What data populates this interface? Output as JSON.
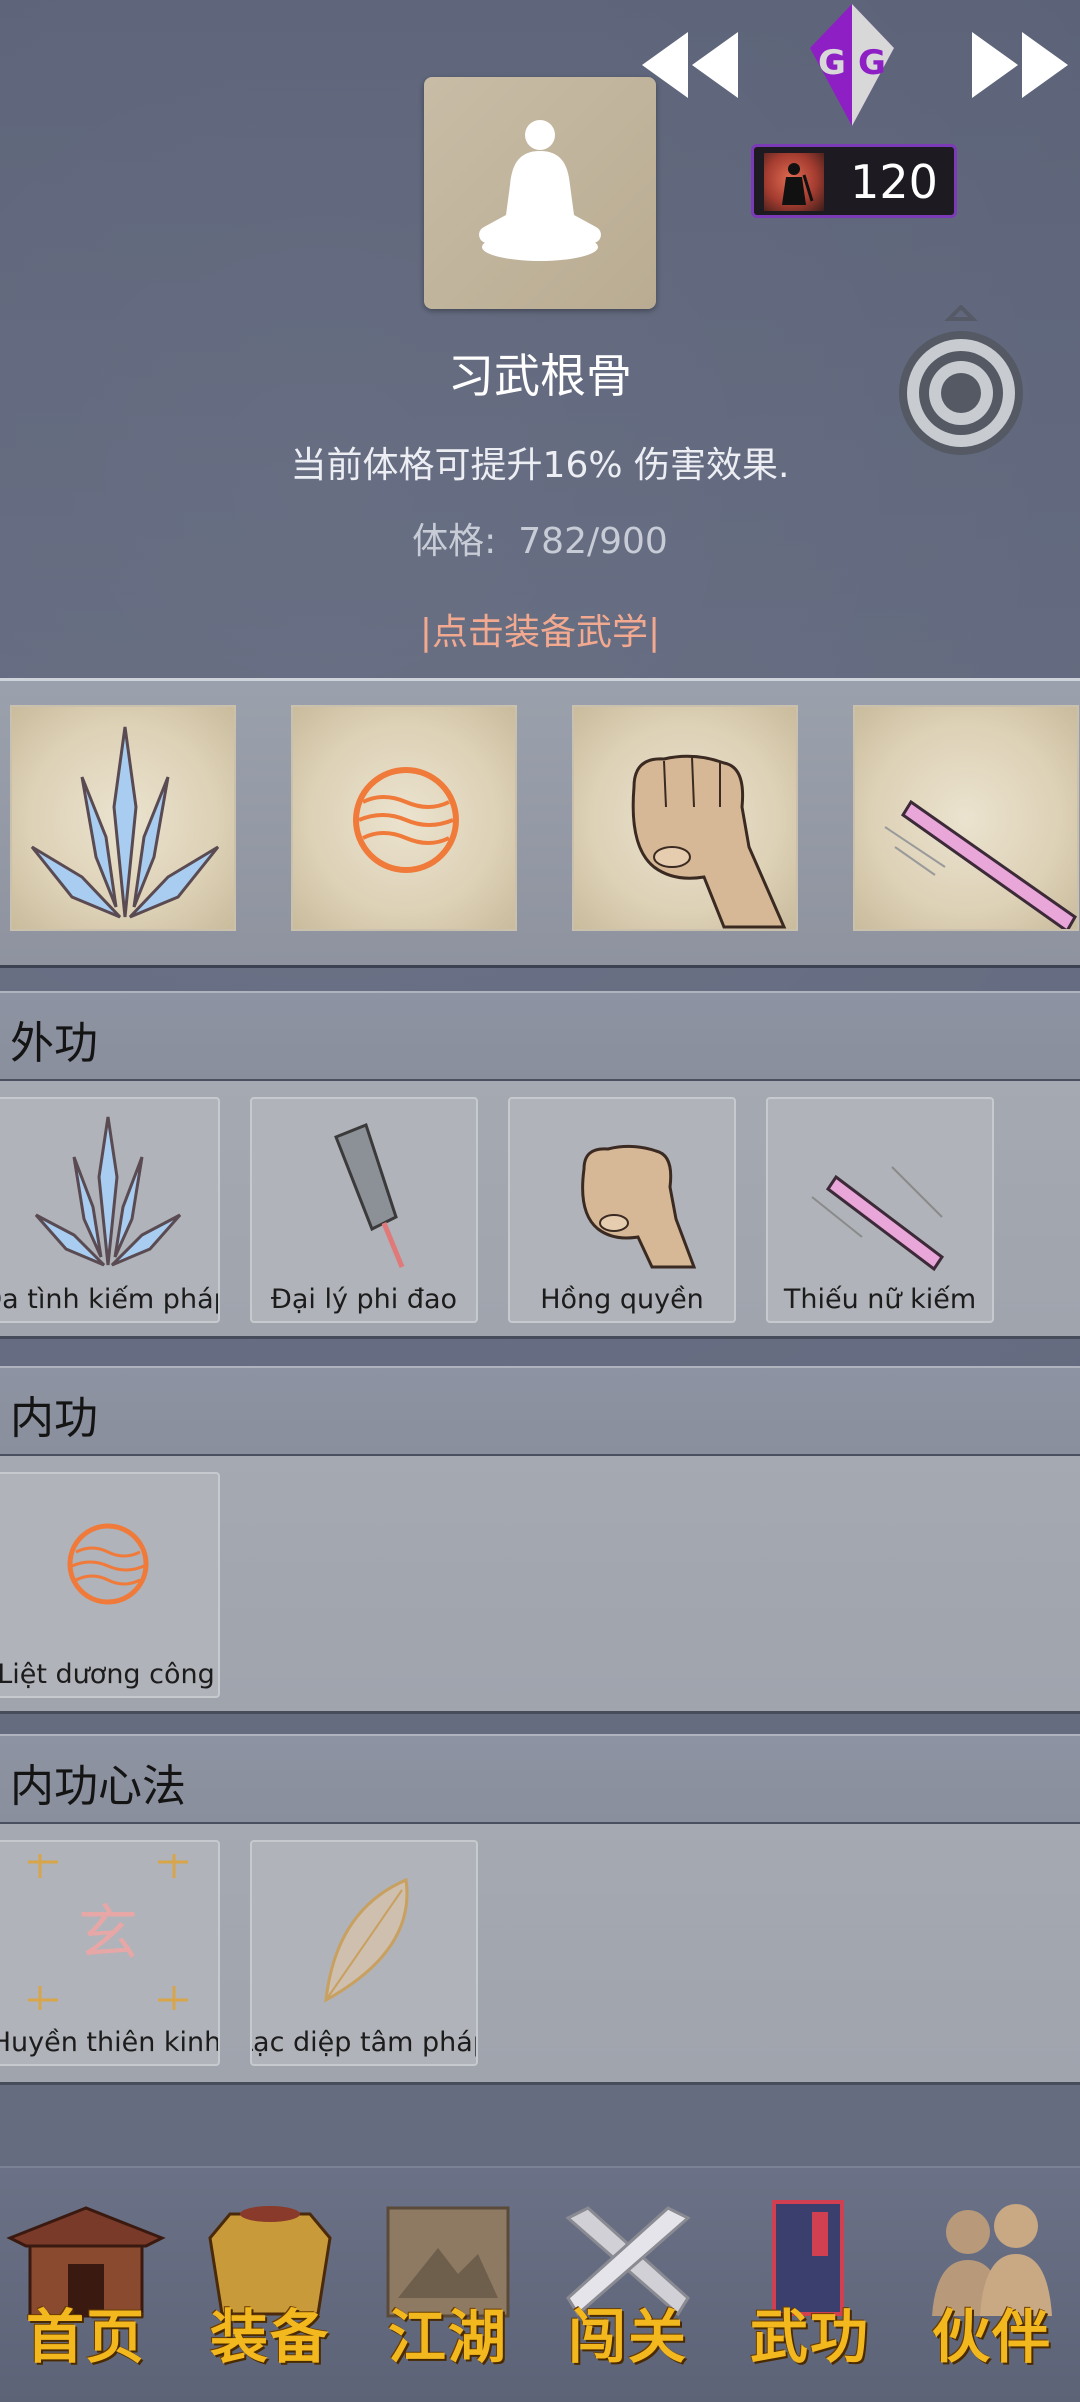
{
  "header": {
    "title": "习武根骨",
    "description": "当前体格可提升16% 伤害效果.",
    "stat_label": "体格:",
    "stat_value": "782/900",
    "equip_link": "|点击装备武学|",
    "coin_count": "120"
  },
  "equipped_slots": [
    {
      "icon": "crystal-sword-icon"
    },
    {
      "icon": "fire-orb-icon"
    },
    {
      "icon": "fist-icon"
    },
    {
      "icon": "pink-sword-icon"
    }
  ],
  "sections": [
    {
      "title": "外功",
      "items": [
        {
          "label": "Đa tình kiếm pháp",
          "icon": "crystal-sword-icon"
        },
        {
          "label": "Đại lý phi đao",
          "icon": "cleaver-icon"
        },
        {
          "label": "Hồng quyền",
          "icon": "fist-icon"
        },
        {
          "label": "Thiếu nữ kiếm",
          "icon": "pink-sword-icon"
        }
      ]
    },
    {
      "title": "内功",
      "items": [
        {
          "label": "Liệt dương công",
          "icon": "fire-orb-icon"
        }
      ]
    },
    {
      "title": "内功心法",
      "items": [
        {
          "label": "Huyền thiên kinh",
          "icon": "xuan-scroll-icon"
        },
        {
          "label": "Lạc diệp tâm pháp",
          "icon": "leaf-icon"
        }
      ]
    }
  ],
  "bottom_nav": [
    {
      "label": "首页",
      "icon": "temple-icon"
    },
    {
      "label": "装备",
      "icon": "armor-icon"
    },
    {
      "label": "江湖",
      "icon": "scroll-map-icon"
    },
    {
      "label": "闯关",
      "icon": "crossed-swords-icon"
    },
    {
      "label": "武功",
      "icon": "book-icon"
    },
    {
      "label": "伙伴",
      "icon": "companions-icon"
    }
  ],
  "colors": {
    "background": "#5d6478",
    "link": "#f2a98f",
    "nav_text": "#f2b81e",
    "coin_border": "#7b3bb6"
  }
}
